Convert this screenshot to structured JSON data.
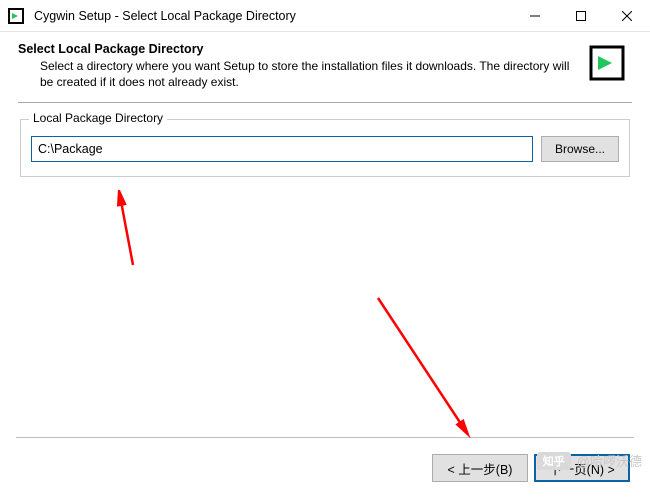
{
  "window": {
    "title": "Cygwin Setup - Select Local Package Directory"
  },
  "header": {
    "title": "Select Local Package Directory",
    "description": "Select a directory where you want Setup to store the installation files it downloads.  The directory will be created if it does not already exist."
  },
  "group": {
    "label": "Local Package Directory",
    "path_value": "C:\\Package",
    "browse_label": "Browse..."
  },
  "footer": {
    "back_label": "< 上一步(B)",
    "next_label": "下一页(N) >"
  },
  "watermark": {
    "badge": "知乎",
    "text": "@哈啰沃德"
  },
  "colors": {
    "accent": "#0a64a4",
    "arrow": "#ff0000"
  }
}
